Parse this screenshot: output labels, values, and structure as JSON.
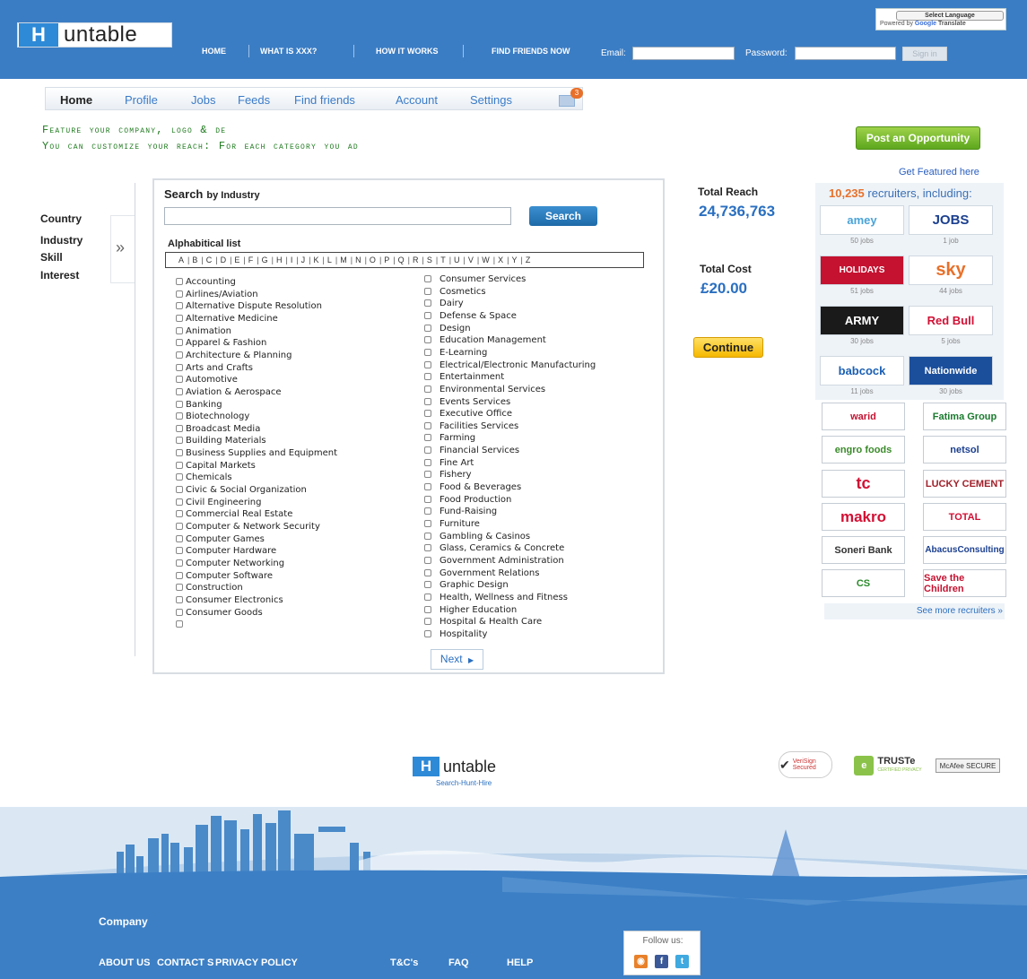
{
  "header": {
    "logo_letter": "H",
    "logo_text": "untable",
    "nav": [
      {
        "label": "HOME"
      },
      {
        "label": "WHAT IS XXX?"
      },
      {
        "label": "HOW IT WORKS"
      },
      {
        "label": "FIND FRIENDS NOW"
      }
    ],
    "email_label": "Email:",
    "password_label": "Password:",
    "email_value": "",
    "password_value": "",
    "signin_label": "Sign in",
    "language_select": "Select Language",
    "powered_by": "Powered by",
    "google": "Google",
    "translate": "Translate"
  },
  "mainnav": {
    "items": [
      {
        "label": "Home"
      },
      {
        "label": "Profile"
      },
      {
        "label": "Jobs"
      },
      {
        "label": "Feeds"
      },
      {
        "label": "Find friends"
      },
      {
        "label": "Account"
      },
      {
        "label": "Settings"
      }
    ],
    "mail_count": "3"
  },
  "feature": {
    "line1": "Feature your company, logo & de",
    "line2": "You can customize your reach: For each category you ad"
  },
  "post_opportunity": "Post an Opportunity",
  "get_featured": "Get Featured here",
  "filters": [
    "Country",
    "Industry",
    "Skill",
    "Interest"
  ],
  "filter_arrow": "»",
  "search": {
    "title": "Search",
    "subtitle": "by Industry",
    "value": "",
    "button": "Search",
    "alpha_title": "Alphabitical list",
    "letters": [
      "A",
      "B",
      "C",
      "D",
      "E",
      "F",
      "G",
      "H",
      "I",
      "J",
      "K",
      "L",
      "M",
      "N",
      "O",
      "P",
      "Q",
      "R",
      "S",
      "T",
      "U",
      "V",
      "W",
      "X",
      "Y",
      "Z"
    ]
  },
  "industries_left": [
    "Accounting",
    "Airlines/Aviation",
    "Alternative Dispute Resolution",
    "Alternative Medicine",
    "Animation",
    "Apparel & Fashion",
    "Architecture & Planning",
    "Arts and Crafts",
    "Automotive",
    "Aviation & Aerospace",
    "Banking",
    "Biotechnology",
    "Broadcast Media",
    "Building Materials",
    "Business Supplies and Equipment",
    "Capital Markets",
    "Chemicals",
    "Civic & Social Organization",
    "Civil Engineering",
    "Commercial Real Estate",
    "Computer & Network Security",
    "Computer Games",
    "Computer Hardware",
    "Computer Networking",
    "Computer Software",
    "Construction",
    "Consumer Electronics",
    "Consumer Goods"
  ],
  "industries_right": [
    "Consumer Services",
    "Cosmetics",
    "Dairy",
    "Defense & Space",
    "Design",
    "Education Management",
    "E-Learning",
    "Electrical/Electronic Manufacturing",
    "Entertainment",
    "Environmental Services",
    "Events Services",
    "Executive Office",
    "Facilities Services",
    "Farming",
    "Financial Services",
    "Fine Art",
    "Fishery",
    "Food & Beverages",
    "Food Production",
    "Fund-Raising",
    "Furniture",
    "Gambling & Casinos",
    "Glass, Ceramics & Concrete",
    "Government Administration",
    "Government Relations",
    "Graphic Design",
    "Health, Wellness and Fitness",
    "Higher Education",
    "Hospital & Health Care",
    "Hospitality"
  ],
  "next_label": "Next",
  "reach": {
    "total_reach_label": "Total Reach",
    "total_reach_value": "24,736,763",
    "total_cost_label": "Total Cost",
    "total_cost_value": "£20.00",
    "continue_label": "Continue"
  },
  "recruiters": {
    "count": "10,235",
    "suffix": "recruiters, including:",
    "featured": [
      {
        "name": "amey",
        "jobs": "50 jobs",
        "color": "#4aa3d8"
      },
      {
        "name": "JOBS",
        "jobs": "1 job",
        "color": "#1b3f8f"
      },
      {
        "name": "HOLIDAYS",
        "jobs": "51 jobs",
        "color": "#c41230"
      },
      {
        "name": "sky",
        "jobs": "44 jobs",
        "color": "#e8702a"
      },
      {
        "name": "ARMY",
        "jobs": "30 jobs",
        "color": "#ffffff"
      },
      {
        "name": "Red Bull",
        "jobs": "5 jobs",
        "color": "#d21034"
      },
      {
        "name": "babcock",
        "jobs": "11 jobs",
        "color": "#1a5fb4"
      },
      {
        "name": "Nationwide",
        "jobs": "30 jobs",
        "color": "#ffffff"
      }
    ],
    "others": [
      {
        "name": "warid",
        "color": "#c41230"
      },
      {
        "name": "Fatima Group",
        "color": "#1a7a2e"
      },
      {
        "name": "engro foods",
        "color": "#3a8a2a"
      },
      {
        "name": "netsol",
        "color": "#1b3f8f"
      },
      {
        "name": "tc",
        "color": "#d21034"
      },
      {
        "name": "LUCKY CEMENT",
        "color": "#a0202a"
      },
      {
        "name": "makro",
        "color": "#d21034"
      },
      {
        "name": "TOTAL",
        "color": "#d21034"
      },
      {
        "name": "Soneri Bank",
        "color": "#333333"
      },
      {
        "name": "AbacusConsulting",
        "color": "#1b3f8f"
      },
      {
        "name": "CS",
        "color": "#2a8a2a"
      },
      {
        "name": "Save the Children",
        "color": "#c41230"
      }
    ],
    "see_more": "See more recruiters »"
  },
  "footer": {
    "logo_letter": "H",
    "logo_text": "untable",
    "tagline": "Search-Hunt-Hire",
    "verisign": "VeriSign Secured",
    "truste": "TRUSTe",
    "truste_sub": "CERTIFIED PRIVACY",
    "mcafee": "McAfee SECURE",
    "company_label": "Company",
    "links": [
      {
        "label": "ABOUT US"
      },
      {
        "label": "CONTACT S"
      },
      {
        "label": "PRIVACY POLICY"
      },
      {
        "label": "T&C's"
      },
      {
        "label": "FAQ"
      },
      {
        "label": "HELP"
      }
    ],
    "follow_us": "Follow us:"
  },
  "colors": {
    "brand_blue": "#3b7dc4",
    "link_blue": "#2a6fc0",
    "accent_green": "#5da71e",
    "accent_orange": "#e8702a",
    "feature_green": "#1f7a1f"
  }
}
